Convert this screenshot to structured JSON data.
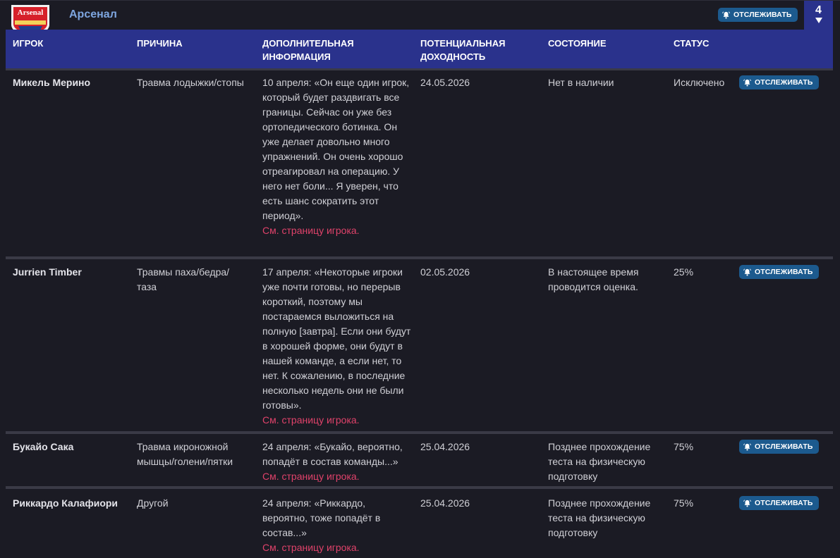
{
  "team": {
    "name": "Арсенал",
    "crest_text": "Arsenal",
    "follow_label": "ОТСЛЕЖИВАТЬ",
    "count": "4"
  },
  "columns": {
    "player": "ИГРОК",
    "reason": "ПРИЧИНА",
    "info": "ДОПОЛНИТЕЛЬНАЯ ИНФОРМАЦИЯ",
    "return": "ПОТЕНЦИАЛЬНАЯ ДОХОДНОСТЬ",
    "condition": "СОСТОЯНИЕ",
    "status": "СТАТУС"
  },
  "rows": [
    {
      "player": "Микель Мерино",
      "reason": "Травма лодыжки/стопы",
      "info": "10 апреля: «Он еще один игрок, который будет раздвигать все границы. Сейчас он уже без ортопедического ботинка. Он уже делает довольно много упражнений. Он очень хорошо отреагировал на операцию. У него нет боли... Я уверен, что есть шанс сократить этот период».",
      "link": "См. страницу игрока.",
      "return": "24.05.2026",
      "condition": "Нет в наличии",
      "status": "Исключено",
      "follow_label": "ОТСЛЕЖИВАТЬ"
    },
    {
      "player": "Jurrien Timber",
      "reason": "Травмы паха/бедра/таза",
      "info": "17 апреля: «Некоторые игроки уже почти готовы, но перерыв короткий, поэтому мы постараемся выложиться на полную [завтра]. Если они будут в хорошей форме, они будут в нашей команде, а если нет, то нет. К сожалению, в последние несколько недель они не были готовы».",
      "link": "См. страницу игрока.",
      "return": "02.05.2026",
      "condition": "В настоящее время проводится оценка.",
      "status": "25%",
      "follow_label": "ОТСЛЕЖИВАТЬ"
    },
    {
      "player": "Букайо Сака",
      "reason": "Травма икроножной мышцы/голени/пятки",
      "info": "24 апреля: «Букайо, вероятно, попадёт в состав команды...»",
      "link": "См. страницу игрока.",
      "return": "25.04.2026",
      "condition": "Позднее прохождение теста на физическую подготовку",
      "status": "75%",
      "follow_label": "ОТСЛЕЖИВАТЬ"
    },
    {
      "player": "Риккардо Калафиори",
      "reason": "Другой",
      "info": "24 апреля: «Риккардо, вероятно, тоже попадёт в состав...»",
      "link": "См. страницу игрока.",
      "return": "25.04.2026",
      "condition": "Позднее прохождение теста на физическую подготовку",
      "status": "75%",
      "follow_label": "ОТСЛЕЖИВАТЬ"
    }
  ],
  "colors": {
    "background": "#1b1b24",
    "header_bar": "#2a328c",
    "team_name": "#7ea6e0",
    "follow_button": "#1c5a8e",
    "link": "#e0426a",
    "separator": "#3a3a46"
  },
  "icons": {
    "follow": "bell-icon",
    "count_toggle": "chevron-down-icon",
    "crest": "arsenal-crest-icon"
  }
}
